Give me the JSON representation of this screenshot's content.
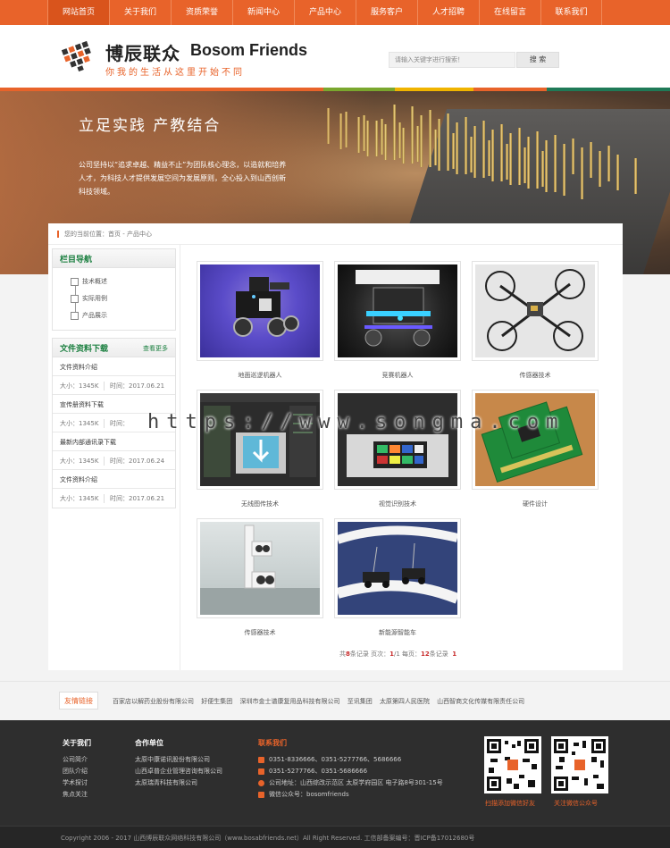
{
  "nav": {
    "items": [
      "网站首页",
      "关于我们",
      "资质荣誉",
      "新闻中心",
      "产品中心",
      "服务客户",
      "人才招聘",
      "在线留言",
      "联系我们"
    ]
  },
  "header": {
    "logo_cn": "博辰联众",
    "logo_en": "Bosom Friends",
    "slogan": "你我的生活从这里开始不同",
    "search_placeholder": "请输入关键字进行搜索！",
    "search_button": "搜 索"
  },
  "banner": {
    "title": "立足实践  产教结合",
    "text": "公司坚持以“追求卓越、精益不止”为团队核心理念，以造就和培养人才，为科技人才提供发展空间为发展原则，全心投入到山西创新科技领域。"
  },
  "breadcrumb": {
    "text": "您的当前位置：首页 - 产品中心"
  },
  "sidebar": {
    "nav_title": "栏目导航",
    "nav_items": [
      "技术概述",
      "实际用例",
      "产品展示"
    ],
    "files_title": "文件资料下载",
    "files_more": "查看更多",
    "files": [
      {
        "title": "文件资料介绍",
        "size": "大小：1345K",
        "time": "时间：2017.06.21"
      },
      {
        "title": "宣传册资料下载",
        "size": "大小：1345K",
        "time": "时间："
      },
      {
        "title": "最新内部通讯录下载",
        "size": "大小：1345K",
        "time": "时间：2017.06.24"
      },
      {
        "title": "文件资料介绍",
        "size": "大小：1345K",
        "time": "时间：2017.06.21"
      }
    ]
  },
  "products": [
    {
      "caption": "地面巡逻机器人",
      "icon": "patrol-robot-image"
    },
    {
      "caption": "竞赛机器人",
      "icon": "competition-robot-image"
    },
    {
      "caption": "传感器技术",
      "icon": "drone-image"
    },
    {
      "caption": "无线图传技术",
      "icon": "wireless-video-image"
    },
    {
      "caption": "视觉识别技术",
      "icon": "vision-recognition-image"
    },
    {
      "caption": "硬件设计",
      "icon": "circuit-board-image"
    },
    {
      "caption": "传感器技术",
      "icon": "sensor-image"
    },
    {
      "caption": "新能源智能车",
      "icon": "smart-car-image"
    }
  ],
  "pager": {
    "prefix": "共",
    "total": "8",
    "records": "条记录  页次：",
    "page": "1",
    "of": "/1 每页：",
    "per_page": "12",
    "suffix": "条记录",
    "current": "1"
  },
  "watermark": "https://www.songma.com",
  "friends": {
    "label": "友情链接",
    "links": [
      "百家店以解药业股份有限公司",
      "好便生集团",
      "深圳市金士谱康复用品科技有限公司",
      "至讯集团",
      "太原第四人民医院",
      "山西智商文化传媒有限责任公司"
    ]
  },
  "footer": {
    "about_title": "关于我们",
    "about_items": [
      "公司简介",
      "团队介绍",
      "学术探讨",
      "焦点关注"
    ],
    "partners_title": "合作单位",
    "partners_items": [
      "太原中康诺讯股份有限公司",
      "山西卓普企业管理咨询有限公司",
      "太原瑞青科技有限公司"
    ],
    "contact_title": "联系我们",
    "contact_items": [
      "0351-8336666、0351-5277766、5686666",
      "0351-5277766、0351-5686666",
      "公司地址：山西综改示范区 太原学府园区 电子路8号301-15号",
      "微信公众号：bosomfriends"
    ],
    "qr1_caption": "扫描添加微信好友",
    "qr2_caption": "关注微信公众号",
    "copyright": "Copyright 2006 - 2017  山西博辰联众网络科技有限公司（www.bosabfriends.net）All Right Reserved.    工信部备案编号：晋ICP备17012680号"
  },
  "colors": {
    "accent": "#e8632a",
    "green": "#1a7f3f",
    "footer_bg": "#2e2e2e"
  }
}
